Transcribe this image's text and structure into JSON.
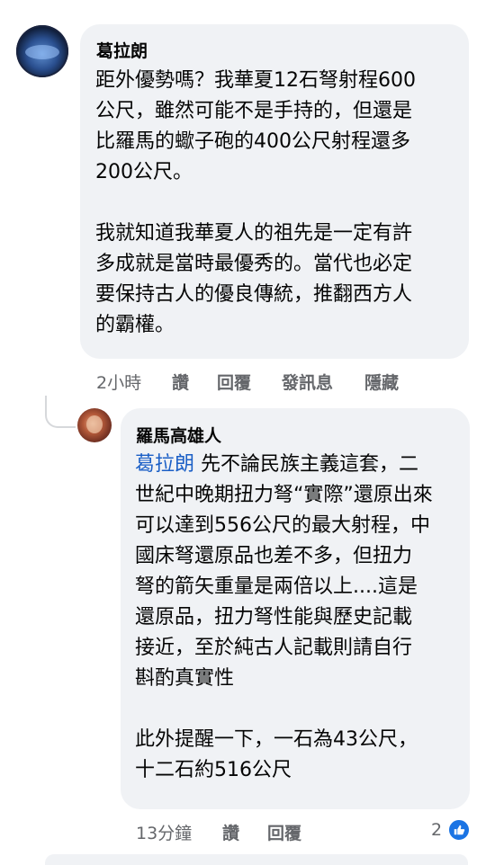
{
  "comment1": {
    "author": "葛拉朗",
    "lines": [
      "距外優勢嗎？我華夏12石弩射程600",
      "公尺，雖然可能不是手持的，但還是",
      "比羅馬的蠍子砲的400公尺射程還多",
      "200公尺。",
      "",
      "我就知道我華夏人的祖先是一定有許",
      "多成就是當時最優秀的。當代也必定",
      "要保持古人的優良傳統，推翻西方人",
      "的霸權。"
    ],
    "actions": {
      "time": "2小時",
      "like": "讚",
      "reply": "回覆",
      "message": "發訊息",
      "hide": "隱藏"
    }
  },
  "comment2": {
    "author": "羅馬高雄人",
    "mention": "葛拉朗",
    "first_line_rest": " 先不論民族主義這套，二",
    "lines": [
      "世紀中晚期扭力弩“實際”還原出來",
      "可以達到556公尺的最大射程，中",
      "國床弩還原品也差不多，但扭力",
      "弩的箭矢重量是兩倍以上....這是",
      "還原品，扭力弩性能與歷史記載",
      "接近，至於純古人記載則請自行",
      "斟酌真實性",
      "",
      "此外提醒一下，一石為43公尺，",
      "十二石約516公尺"
    ],
    "actions": {
      "time": "13分鐘",
      "like": "讚",
      "reply": "回覆"
    },
    "reaction_count": "2",
    "colors": {
      "mention": "#1b5fc6",
      "like_icon": "#1b74e4"
    }
  }
}
